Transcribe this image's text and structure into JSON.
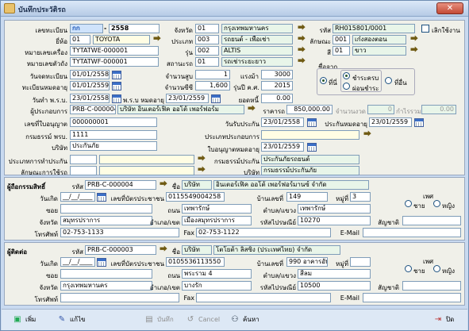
{
  "window": {
    "title": "บันทึกประวัติรถ"
  },
  "vehicle": {
    "reg_label": "เลขทะเบียน",
    "reg_prefix": "กก",
    "reg_number": "2558",
    "province_label": "จังหวัด",
    "province_code": "01",
    "province_name": "กรุงเทพมหานคร",
    "code_label": "รหัส",
    "code_value": "RH015801/0001",
    "cancel_label": "เลิกใช้งาน",
    "brand_label": "ยี่ห้อ",
    "brand_code": "01",
    "brand_name": "TOYOTA",
    "type_label": "ประเภท",
    "type_code": "003",
    "type_name": "รถยนต์ - เพื่อเช่า",
    "chars_label": "ลักษณะ",
    "chars_code": "001",
    "chars_name": "เก๋งสองตอน",
    "chassis_label": "หมายเลขเครื่อง",
    "chassis_value": "TYTATWE-000001",
    "model_label": "รุ่น",
    "model_code": "002",
    "model_name": "ALTIS",
    "color_label": "สี",
    "color_code": "01",
    "color_name": "ขาว",
    "engine_label": "หมายเลขตัวถัง",
    "engine_value": "TYTATWF-000001",
    "status_label": "สถานะรถ",
    "status_code": "01",
    "status_name": "รถเช่าระยะยาว",
    "regdate_label": "วันจดทะเบียน",
    "regdate_value": "01/01/2558",
    "seats_label": "จำนวนสูบ",
    "seats_value": "1",
    "power_label": "แรงม้า",
    "power_value": "3000",
    "regexp_label": "ทะเบียนหมดอายุ",
    "regexp_value": "01/01/2559",
    "ton_label": "จำนวนซีซี",
    "ton_value": "1,600",
    "year_label": "รุ่นปี ค.ศ.",
    "year_value": "2015",
    "act_label": "วันทำ พ.ร.บ.",
    "act_value": "23/01/2558",
    "actexp_label": "พ.ร.บ หมดอายุ",
    "actexp_value": "23/01/2559",
    "mileage_label": "ยอดหนี้",
    "mileage_value": "0.00",
    "dealer_label": "ผู้ประกอบการ",
    "dealer_code": "PRB-C-000004",
    "dealer_name": "บริษัท อินเตอร์เฟิค ออโต้ เพอร์ฟอร์ม",
    "price_label": "ราคารถ",
    "price_value": "850,000.00",
    "installment_label": "จำนวนงวด",
    "installment_value": "0",
    "interest_label": "กำไรรวม",
    "interest_value": "0.00",
    "license_label": "เลขที่ใบอนุญาต",
    "license_value": "000000001",
    "insstart_label": "วันรับประกัน",
    "insstart_value": "23/01/2558",
    "insexp_label": "ประกันหมดอายุ",
    "insexp_value": "23/01/2559",
    "policy_label": "กรมธรรม์ พรบ.",
    "policy_value": "1111",
    "insurer_label": "ประเภทประกอบการ",
    "insurer_value": "",
    "company_label": "บริษัท",
    "company_value": "ประกันภัย",
    "permitexp_label": "ใบอนุญาตหมดอายุ",
    "permitexp_value": "23/01/2559",
    "instype_label": "ประเภทการทำประกัน",
    "instype_value": "",
    "policytype_label": "กรมธรรม์ประกัน",
    "policytype_value": "ประกันภัยรถยนต์",
    "usage_label": "ลักษณะการใช้รถ",
    "usage_value": "",
    "company2_label": "บริษัท",
    "company2_value": "กรมธรรม์ประกันภัย"
  },
  "ownership": {
    "group_label": "ชื่อจาก",
    "opt1": "ที่นี่",
    "opt2": "ที่อื่น",
    "sub1": "ชำระครบ",
    "sub2": "ผ่อนชำระ"
  },
  "owner": {
    "section_label": "ผู้ถือกรรมสิทธิ์",
    "code_label": "รหัส",
    "code_value": "PRB-C-000004",
    "name_label": "ชื่อ",
    "title_value": "บริษัท",
    "name_value": "อินเตอร์เฟิค ออโต้ เพอร์ฟอร์มานซ์ จำกัด",
    "dob_label": "วันเกิด",
    "dob_value": "__/__/____",
    "idcard_label": "เลขที่บัตรประชาชน",
    "idcard_value": "0115549004258",
    "addr_label": "บ้านเลขที่",
    "addr_value": "149",
    "moo_label": "หมู่ที่",
    "moo_value": "3",
    "sex_label": "เพศ",
    "male": "ชาย",
    "female": "หญิง",
    "soi_label": "ซอย",
    "soi_value": "",
    "road_label": "ถนน",
    "road_value": "เทพารักษ์",
    "subdistrict_label": "ตำบล/แขวง",
    "subdistrict_value": "เทพารักษ์",
    "province_label": "จังหวัด",
    "province_value": "สมุทรปราการ",
    "district_label": "อำเภอ/เขต",
    "district_value": "เมืองสมุทรปราการ",
    "zip_label": "รหัสไปรษณีย์",
    "zip_value": "10270",
    "nation_label": "สัญชาติ",
    "nation_value": "",
    "phone_label": "โทรศัพท์",
    "phone_value": "02-753-1133",
    "fax_label": "Fax",
    "fax_value": "02-753-1122",
    "email_label": "E-Mail",
    "email_value": ""
  },
  "holder": {
    "section_label": "ผู้ติดต่อ",
    "code_label": "รหัส",
    "code_value": "PRB-C-000003",
    "name_label": "ชื่อ",
    "title_value": "บริษัท",
    "name_value": "โตโยต้า ลิสซิ่ง (ประเทศไทย) จำกัด",
    "dob_label": "วันเกิด",
    "dob_value": "__/__/____",
    "idcard_label": "เลขที่บัตรประชาชน",
    "idcard_value": "0105536113550",
    "addr_label": "บ้านเลขที่",
    "addr_value": "990 อาคารอับดุ",
    "moo_label": "หมู่ที่",
    "moo_value": "",
    "sex_label": "เพศ",
    "male": "ชาย",
    "female": "หญิง",
    "soi_label": "ซอย",
    "soi_value": "",
    "road_label": "ถนน",
    "road_value": "พระราม 4",
    "subdistrict_label": "ตำบล/แขวง",
    "subdistrict_value": "สีลม",
    "province_label": "จังหวัด",
    "province_value": "กรุงเทพมหานคร",
    "district_label": "อำเภอ/เขต",
    "district_value": "บางรัก",
    "zip_label": "รหัสไปรษณีย์",
    "zip_value": "10500",
    "nation_label": "สัญชาติ",
    "nation_value": "",
    "phone_label": "โทรศัพท์",
    "phone_value": "",
    "fax_label": "Fax",
    "fax_value": "",
    "email_label": "E-Mail",
    "email_value": ""
  },
  "toolbar": {
    "add": "เพิ่ม",
    "edit": "แก้ไข",
    "save": "บันทึก",
    "cancel": "Cancel",
    "search": "ค้นหา",
    "close": "ปิด"
  }
}
